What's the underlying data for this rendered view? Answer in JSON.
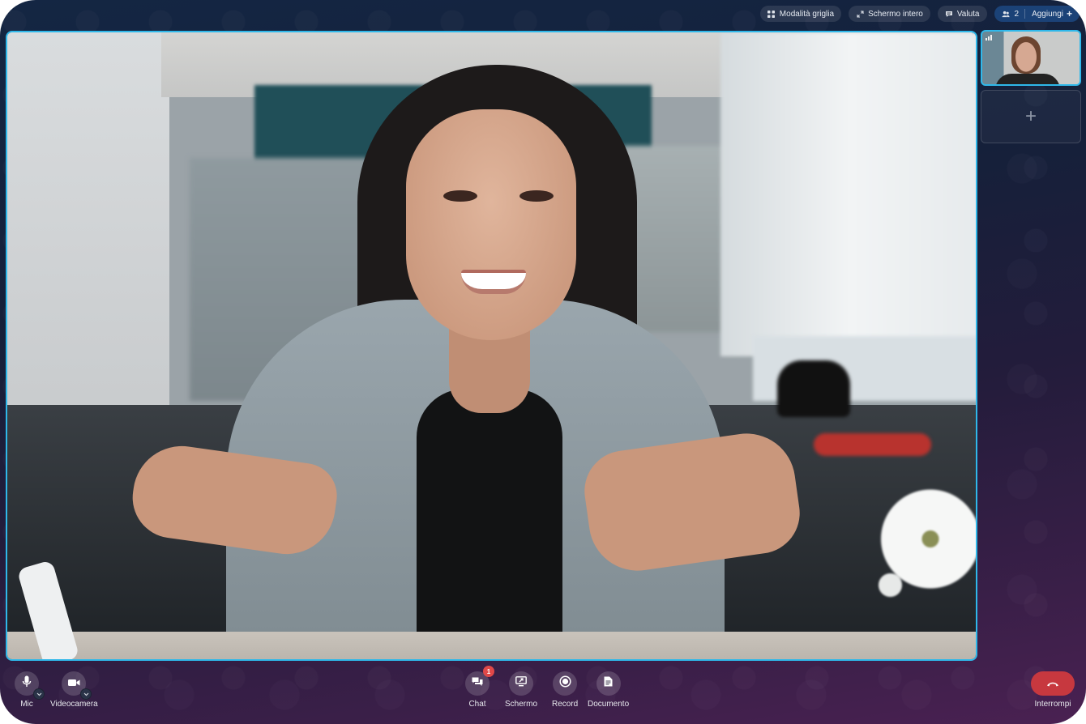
{
  "topbar": {
    "grid_mode": {
      "label": "Modalità griglia",
      "icon": "grid-icon"
    },
    "fullscreen": {
      "label": "Schermo intero",
      "icon": "expand-icon"
    },
    "rate": {
      "label": "Valuta",
      "icon": "message-icon"
    },
    "participants": {
      "count": "2",
      "add_label": "Aggiungi",
      "plus": "+",
      "icon": "users-icon"
    }
  },
  "main_video": {
    "description": "Woman with long dark hair in grey blazer smiling and gesturing in an office",
    "accent_border": "#2fb8ea"
  },
  "side_panel": {
    "thumbnail": {
      "description": "Woman with short curly hair, smiling",
      "signal_icon": "signal-bars-icon"
    },
    "add_slot": {
      "symbol": "+"
    }
  },
  "controls": {
    "left": [
      {
        "label": "Mic",
        "icon": "microphone-icon",
        "has_menu": true
      },
      {
        "label": "Videocamera",
        "icon": "video-camera-icon",
        "has_menu": true
      }
    ],
    "center": [
      {
        "label": "Chat",
        "icon": "chat-icon",
        "badge": "1"
      },
      {
        "label": "Schermo",
        "icon": "screen-share-icon"
      },
      {
        "label": "Record",
        "icon": "record-icon"
      },
      {
        "label": "Documento",
        "icon": "document-icon"
      }
    ],
    "right": {
      "label": "Interrompi",
      "icon": "hang-up-icon",
      "color": "#c7383f"
    }
  }
}
